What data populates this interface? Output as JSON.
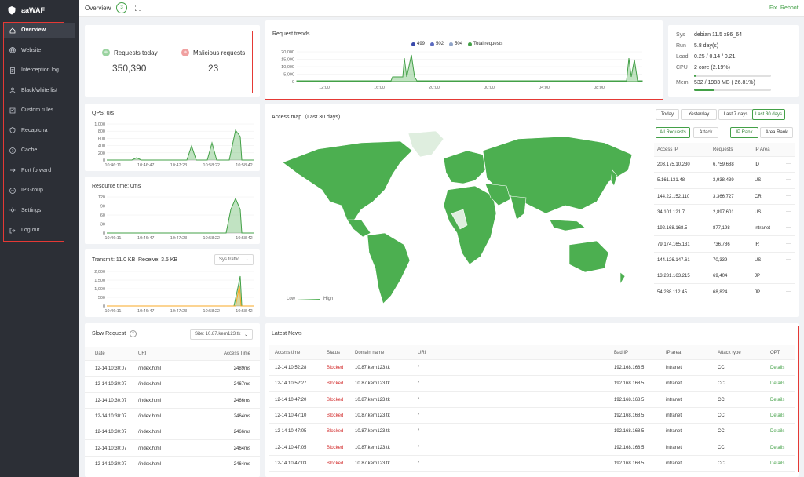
{
  "app": {
    "title": "aaWAF"
  },
  "sidebar": {
    "items": [
      {
        "label": "Overview",
        "icon": "home-icon",
        "active": true
      },
      {
        "label": "Website",
        "icon": "globe-icon"
      },
      {
        "label": "Interception log",
        "icon": "log-icon"
      },
      {
        "label": "Black/white list",
        "icon": "user-list-icon"
      },
      {
        "label": "Custom rules",
        "icon": "rules-icon"
      },
      {
        "label": "Recaptcha",
        "icon": "captcha-icon"
      },
      {
        "label": "Cache",
        "icon": "cache-icon"
      },
      {
        "label": "Port forward",
        "icon": "port-icon"
      },
      {
        "label": "IP Group",
        "icon": "ip-group-icon"
      },
      {
        "label": "Settings",
        "icon": "gear-icon"
      },
      {
        "label": "Log out",
        "icon": "logout-icon"
      }
    ]
  },
  "topbar": {
    "title": "Overview",
    "score": "3",
    "fix": "Fix",
    "reboot": "Reboot"
  },
  "stats": {
    "requests_label": "Requests today",
    "requests_value": "350,390",
    "malicious_label": "Malicious requests",
    "malicious_value": "23"
  },
  "qps": {
    "title": "QPS: 0/s",
    "yticks": [
      "1,000",
      "800",
      "600",
      "400",
      "200",
      "0"
    ],
    "xticks": [
      "10:46:11",
      "10:46:47",
      "10:47:23",
      "10:58:22",
      "10:58:42"
    ]
  },
  "resource": {
    "title": "Resource time: 0ms",
    "yticks": [
      "120",
      "90",
      "60",
      "30",
      "0"
    ],
    "xticks": [
      "10:46:11",
      "10:46:47",
      "10:47:23",
      "10:58:22",
      "10:58:42"
    ]
  },
  "traffic": {
    "transmit": "Transmit: 11.0 KB",
    "receive": "Receive: 3.5 KB",
    "select": "Sys traffic",
    "yticks": [
      "2,000",
      "1,500",
      "1,000",
      "500",
      "0"
    ],
    "xticks": [
      "10:46:11",
      "10:46:47",
      "10:47:23",
      "10:58:22",
      "10:58:42"
    ]
  },
  "trends": {
    "title": "Request trends",
    "legend": [
      "499",
      "502",
      "504",
      "Total requests"
    ],
    "legend_colors": [
      "#3949ab",
      "#5c6bc0",
      "#90a4c8",
      "#43a047"
    ],
    "yticks": [
      "20,000",
      "15,000",
      "10,000",
      "5,000",
      "0"
    ],
    "xticks": [
      "12:00",
      "16:00",
      "20:00",
      "00:00",
      "04:00",
      "08:00"
    ]
  },
  "sys": {
    "rows": [
      {
        "label": "Sys",
        "value": "debian 11.5 x86_64"
      },
      {
        "label": "Run",
        "value": "5.8 day(s)"
      },
      {
        "label": "Load",
        "value": "0.25 / 0.14 / 0.21"
      },
      {
        "label": "CPU",
        "value": "2 core (2.19%)"
      },
      {
        "label": "Mem",
        "value": "532 / 1983 MB ( 26.81%)"
      }
    ],
    "cpu_percent": 2.19,
    "mem_percent": 26.81
  },
  "map": {
    "title": "Access map（Last 30 days)",
    "ranges": [
      "Today",
      "Yesterday",
      "Last 7 days",
      "Last 30 days"
    ],
    "filters": [
      "All Requests",
      "Attack"
    ],
    "ranks": [
      "IP Rank",
      "Area Rank"
    ],
    "legend_low": "Low",
    "legend_high": "High",
    "table_headers": [
      "Access IP",
      "Requests",
      "IP Area"
    ],
    "rows": [
      [
        "203.175.10.230",
        "6,759,688",
        "ID"
      ],
      [
        "5.161.131.48",
        "3,938,439",
        "US"
      ],
      [
        "144.22.152.110",
        "3,366,727",
        "CR"
      ],
      [
        "34.101.121.7",
        "2,897,601",
        "US"
      ],
      [
        "192.168.168.5",
        "877,198",
        "intranet"
      ],
      [
        "79.174.165.131",
        "736,786",
        "IR"
      ],
      [
        "144.126.147.61",
        "70,339",
        "US"
      ],
      [
        "13.231.163.215",
        "69,404",
        "JP"
      ],
      [
        "54.238.112.45",
        "68,824",
        "JP"
      ]
    ],
    "more": "···"
  },
  "slow": {
    "title": "Slow Request",
    "site": "Site: 10.87.kern123.tk",
    "headers": [
      "Date",
      "URI",
      "Access Time"
    ],
    "rows": [
      [
        "12-14 10:30:07",
        "/index.html",
        "2489ms"
      ],
      [
        "12-14 10:30:07",
        "/index.html",
        "2467ms"
      ],
      [
        "12-14 10:30:07",
        "/index.html",
        "2466ms"
      ],
      [
        "12-14 10:30:07",
        "/index.html",
        "2464ms"
      ],
      [
        "12-14 10:30:07",
        "/index.html",
        "2466ms"
      ],
      [
        "12-14 10:30:07",
        "/index.html",
        "2464ms"
      ],
      [
        "12-14 10:30:07",
        "/index.html",
        "2464ms"
      ]
    ]
  },
  "news": {
    "title": "Latest News",
    "headers": [
      "Access time",
      "Status",
      "Domain name",
      "URI",
      "Bad IP",
      "IP area",
      "Attack type",
      "OPT"
    ],
    "rows": [
      [
        "12-14 10:52:28",
        "Blocked",
        "10.87.kern123.tk",
        "/",
        "192.168.168.5",
        "intranet",
        "CC",
        "Details"
      ],
      [
        "12-14 10:52:27",
        "Blocked",
        "10.87.kern123.tk",
        "/",
        "192.168.168.5",
        "intranet",
        "CC",
        "Details"
      ],
      [
        "12-14 10:47:20",
        "Blocked",
        "10.87.kern123.tk",
        "/",
        "192.168.168.5",
        "intranet",
        "CC",
        "Details"
      ],
      [
        "12-14 10:47:10",
        "Blocked",
        "10.87.kern123.tk",
        "/",
        "192.168.168.5",
        "intranet",
        "CC",
        "Details"
      ],
      [
        "12-14 10:47:05",
        "Blocked",
        "10.87.kern123.tk",
        "/",
        "192.168.168.5",
        "intranet",
        "CC",
        "Details"
      ],
      [
        "12-14 10:47:05",
        "Blocked",
        "10.87.kern123.tk",
        "/",
        "192.168.168.5",
        "intranet",
        "CC",
        "Details"
      ],
      [
        "12-14 10:47:03",
        "Blocked",
        "10.87.kern123.tk",
        "/",
        "192.168.168.5",
        "intranet",
        "CC",
        "Details"
      ]
    ]
  }
}
